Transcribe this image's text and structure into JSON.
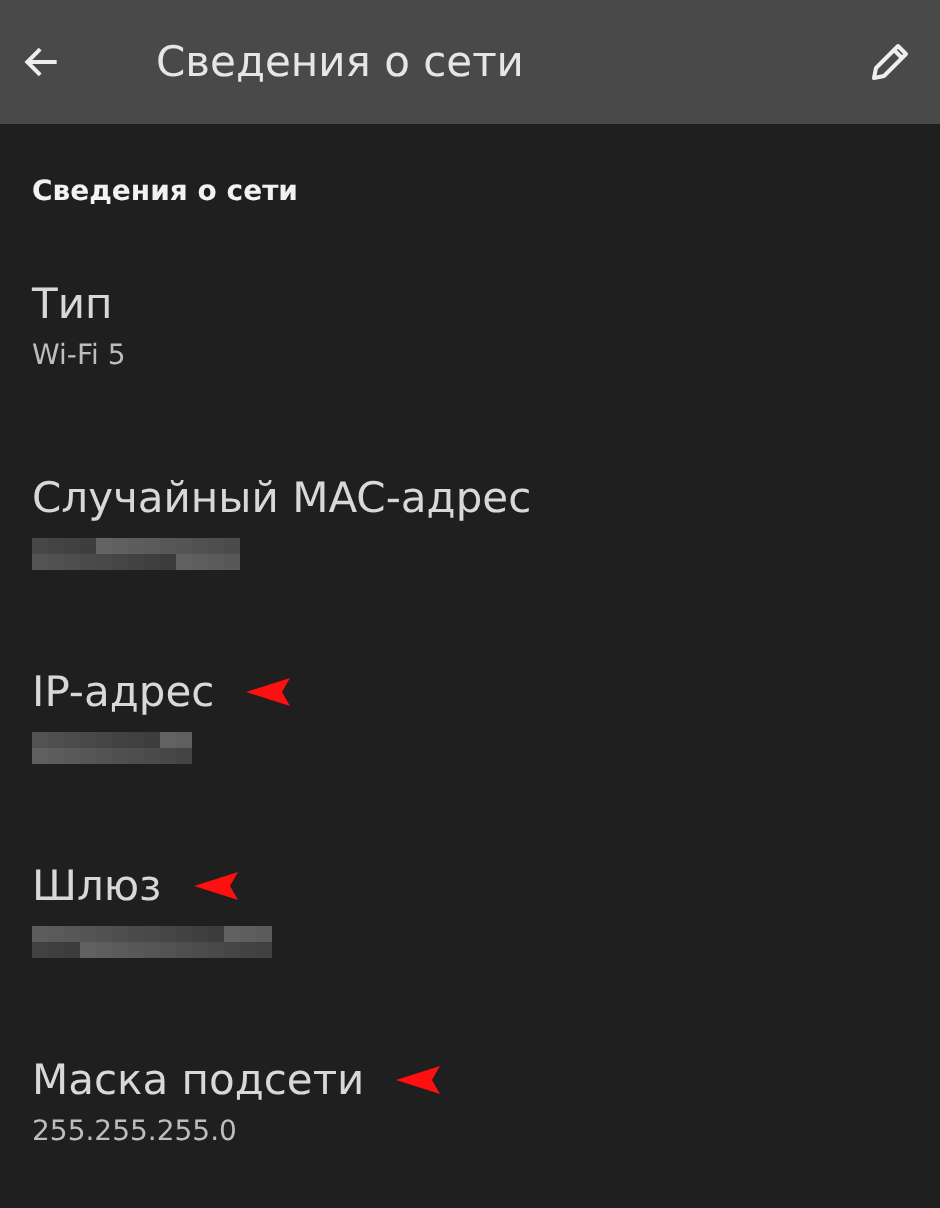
{
  "app_bar": {
    "title": "Сведения о сети"
  },
  "section": {
    "title": "Сведения о сети"
  },
  "items": [
    {
      "label": "Тип",
      "kind": "text",
      "value": "Wi-Fi 5",
      "marked": false
    },
    {
      "label": "Случайный MAC-адрес",
      "kind": "redacted",
      "marked": false
    },
    {
      "label": "IP-адрес",
      "kind": "redacted",
      "marked": true
    },
    {
      "label": "Шлюз",
      "kind": "redacted",
      "marked": true
    },
    {
      "label": "Маска подсети",
      "kind": "text",
      "value": "255.255.255.0",
      "marked": true
    }
  ]
}
